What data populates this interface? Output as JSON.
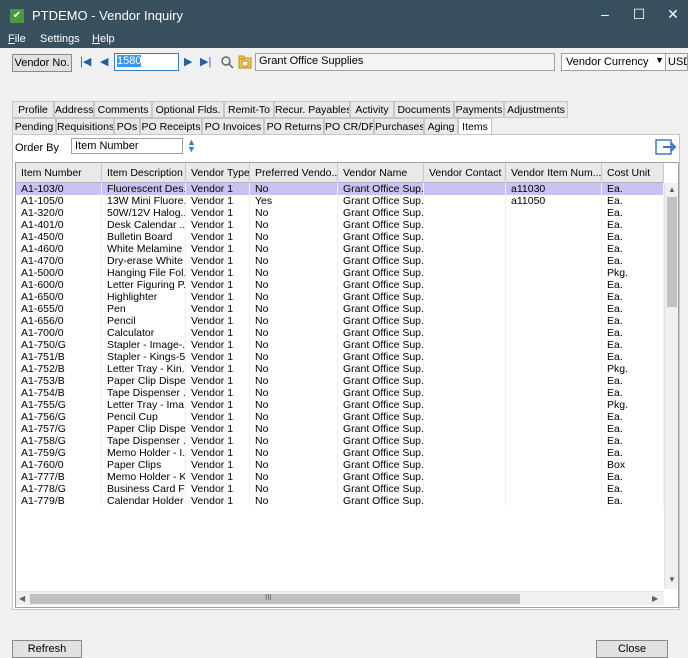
{
  "window": {
    "title": "PTDEMO - Vendor Inquiry",
    "minimize": "–",
    "maximize": "☐",
    "close": "✕"
  },
  "menu": {
    "file": "File",
    "settings": "Settings",
    "help": "Help"
  },
  "toolbar": {
    "vendor_no_label": "Vendor No.",
    "vendor_no_value": "1580",
    "vendor_name": "Grant Office Supplies",
    "currency_label": "Vendor Currency",
    "currency_code": "USD",
    "nav_first": "|◀",
    "nav_prev": "◀",
    "nav_next": "▶",
    "nav_last": "▶|"
  },
  "tabs_row1": [
    "Profile",
    "Address",
    "Comments",
    "Optional Flds.",
    "Remit-To",
    "Recur. Payables",
    "Activity",
    "Documents",
    "Payments",
    "Adjustments"
  ],
  "tabs_row2": [
    "Pending",
    "Requisitions",
    "POs",
    "PO Receipts",
    "PO Invoices",
    "PO Returns",
    "PO CR/DR",
    "Purchases",
    "Aging",
    "Items"
  ],
  "active_tab": "Items",
  "order_by": {
    "label": "Order By",
    "value": "Item Number"
  },
  "columns": [
    "Item Number",
    "Item Description",
    "Vendor Type",
    "Preferred Vendo...",
    "Vendor Name",
    "Vendor Contact",
    "Vendor Item Num...",
    "Cost Unit"
  ],
  "rows": [
    [
      "A1-103/0",
      "Fluorescent Des...",
      "Vendor 1",
      "No",
      "Grant Office Sup...",
      "",
      "a11030",
      "Ea."
    ],
    [
      "A1-105/0",
      "13W Mini Fluore...",
      "Vendor 1",
      "Yes",
      "Grant Office Sup...",
      "",
      "a11050",
      "Ea."
    ],
    [
      "A1-320/0",
      "50W/12V Halog...",
      "Vendor 1",
      "No",
      "Grant Office Sup...",
      "",
      "",
      "Ea."
    ],
    [
      "A1-401/0",
      "Desk Calendar ...",
      "Vendor 1",
      "No",
      "Grant Office Sup...",
      "",
      "",
      "Ea."
    ],
    [
      "A1-450/0",
      "Bulletin Board",
      "Vendor 1",
      "No",
      "Grant Office Sup...",
      "",
      "",
      "Ea."
    ],
    [
      "A1-460/0",
      "White Melamine ...",
      "Vendor 1",
      "No",
      "Grant Office Sup...",
      "",
      "",
      "Ea."
    ],
    [
      "A1-470/0",
      "Dry-erase White ...",
      "Vendor 1",
      "No",
      "Grant Office Sup...",
      "",
      "",
      "Ea."
    ],
    [
      "A1-500/0",
      "Hanging File Fol...",
      "Vendor 1",
      "No",
      "Grant Office Sup...",
      "",
      "",
      "Pkg."
    ],
    [
      "A1-600/0",
      "Letter Figuring P...",
      "Vendor 1",
      "No",
      "Grant Office Sup...",
      "",
      "",
      "Ea."
    ],
    [
      "A1-650/0",
      "Highlighter",
      "Vendor 1",
      "No",
      "Grant Office Sup...",
      "",
      "",
      "Ea."
    ],
    [
      "A1-655/0",
      "Pen",
      "Vendor 1",
      "No",
      "Grant Office Sup...",
      "",
      "",
      "Ea."
    ],
    [
      "A1-656/0",
      "Pencil",
      "Vendor 1",
      "No",
      "Grant Office Sup...",
      "",
      "",
      "Ea."
    ],
    [
      "A1-700/0",
      "Calculator",
      "Vendor 1",
      "No",
      "Grant Office Sup...",
      "",
      "",
      "Ea."
    ],
    [
      "A1-750/G",
      "Stapler - Image-...",
      "Vendor 1",
      "No",
      "Grant Office Sup...",
      "",
      "",
      "Ea."
    ],
    [
      "A1-751/B",
      "Stapler - Kings-5...",
      "Vendor 1",
      "No",
      "Grant Office Sup...",
      "",
      "",
      "Ea."
    ],
    [
      "A1-752/B",
      "Letter Tray - Kin...",
      "Vendor 1",
      "No",
      "Grant Office Sup...",
      "",
      "",
      "Pkg."
    ],
    [
      "A1-753/B",
      "Paper Clip Dispe...",
      "Vendor 1",
      "No",
      "Grant Office Sup...",
      "",
      "",
      "Ea."
    ],
    [
      "A1-754/B",
      "Tape Dispenser ...",
      "Vendor 1",
      "No",
      "Grant Office Sup...",
      "",
      "",
      "Ea."
    ],
    [
      "A1-755/G",
      "Letter Tray - Ima...",
      "Vendor 1",
      "No",
      "Grant Office Sup...",
      "",
      "",
      "Pkg."
    ],
    [
      "A1-756/G",
      "Pencil Cup",
      "Vendor 1",
      "No",
      "Grant Office Sup...",
      "",
      "",
      "Ea."
    ],
    [
      "A1-757/G",
      "Paper Clip Dispe...",
      "Vendor 1",
      "No",
      "Grant Office Sup...",
      "",
      "",
      "Ea."
    ],
    [
      "A1-758/G",
      "Tape Dispenser ...",
      "Vendor 1",
      "No",
      "Grant Office Sup...",
      "",
      "",
      "Ea."
    ],
    [
      "A1-759/G",
      "Memo Holder - I...",
      "Vendor 1",
      "No",
      "Grant Office Sup...",
      "",
      "",
      "Ea."
    ],
    [
      "A1-760/0",
      "Paper Clips",
      "Vendor 1",
      "No",
      "Grant Office Sup...",
      "",
      "",
      "Box"
    ],
    [
      "A1-777/B",
      "Memo Holder - K...",
      "Vendor 1",
      "No",
      "Grant Office Sup...",
      "",
      "",
      "Ea."
    ],
    [
      "A1-778/G",
      "Business Card Fi...",
      "Vendor 1",
      "No",
      "Grant Office Sup...",
      "",
      "",
      "Ea."
    ],
    [
      "A1-779/B",
      "Calendar Holder ...",
      "Vendor 1",
      "No",
      "Grant Office Sup...",
      "",
      "",
      "Ea."
    ]
  ],
  "hscroll_mark": "III",
  "footer": {
    "refresh_label": "Refresh",
    "close_label": "Close"
  },
  "colors": {
    "titlebar": "#384f5e",
    "selected_row": "#c9c3f5",
    "accent": "#3b79c7"
  },
  "icons": [
    "app-icon",
    "nav-first-icon",
    "nav-prev-icon",
    "nav-next-icon",
    "nav-last-icon",
    "search-icon",
    "open-folder-icon",
    "order-spin-icon",
    "export-icon"
  ]
}
